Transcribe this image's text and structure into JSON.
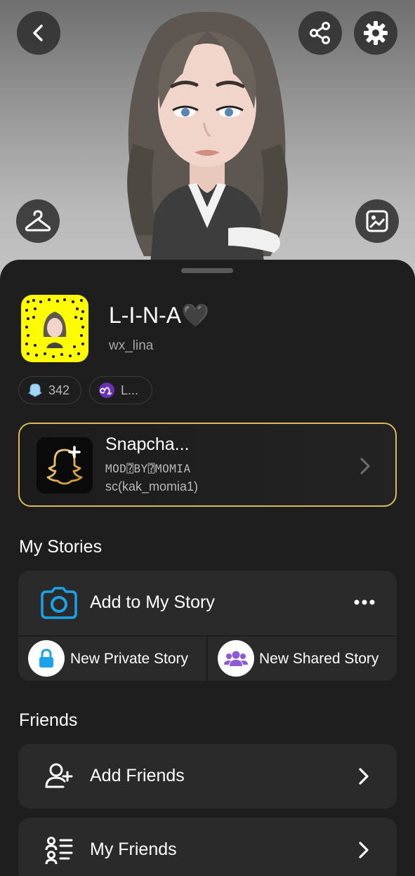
{
  "profile": {
    "display_name": "L-I-N-A🖤",
    "username": "wx_lina"
  },
  "chips": [
    {
      "icon": "ghost-score-icon",
      "label": "342"
    },
    {
      "icon": "zodiac-leo-icon",
      "label": "L..."
    }
  ],
  "snapchat_plus": {
    "title": "Snapcha...",
    "line1": "MOD⍰BY⍰MOMIA",
    "line2": "sc(kak_momia1)"
  },
  "stories": {
    "section_title": "My Stories",
    "add_label": "Add to My Story",
    "private_label": "New Private Story",
    "shared_label": "New Shared Story"
  },
  "friends": {
    "section_title": "Friends",
    "add_friends_label": "Add Friends",
    "my_friends_label": "My Friends"
  },
  "colors": {
    "accent_blue": "#1aa3e8",
    "gold_border": "#d9b95a",
    "snapcode_yellow": "#fffc00",
    "purple": "#8e5bd6"
  }
}
